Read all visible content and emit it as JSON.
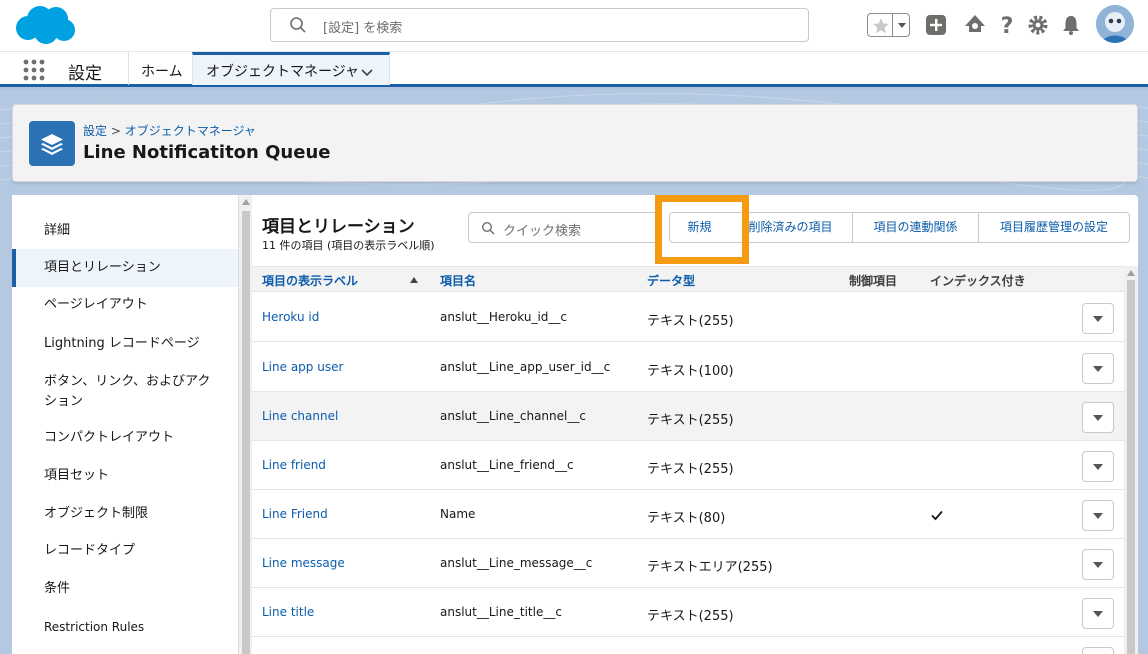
{
  "header": {
    "search_placeholder": "[設定] を検索"
  },
  "nav": {
    "app_name": "設定",
    "tabs": [
      {
        "label": "ホーム"
      },
      {
        "label": "オブジェクトマネージャ"
      }
    ]
  },
  "page": {
    "breadcrumb_root": "設定",
    "breadcrumb_sep": ">",
    "breadcrumb_current": "オブジェクトマネージャ",
    "title": "Line Notificatiton Queue"
  },
  "sidebar": {
    "items": [
      {
        "label": "詳細"
      },
      {
        "label": "項目とリレーション"
      },
      {
        "label": "ページレイアウト"
      },
      {
        "label": "Lightning レコードページ"
      },
      {
        "label": "ボタン、リンク、およびアクション"
      },
      {
        "label": "コンパクトレイアウト"
      },
      {
        "label": "項目セット"
      },
      {
        "label": "オブジェクト制限"
      },
      {
        "label": "レコードタイプ"
      },
      {
        "label": "条件"
      },
      {
        "label": "Restriction Rules"
      }
    ]
  },
  "section": {
    "title": "項目とリレーション",
    "subtitle": "11 件の項目 (項目の表示ラベル順)",
    "quick_search_placeholder": "クイック検索",
    "buttons": {
      "new": "新規",
      "deleted": "削除済みの項目",
      "dependencies": "項目の連動関係",
      "history": "項目履歴管理の設定"
    }
  },
  "table": {
    "columns": [
      "項目の表示ラベル",
      "項目名",
      "データ型",
      "制御項目",
      "インデックス付き"
    ],
    "rows": [
      {
        "label": "Heroku id",
        "name": "anslut__Heroku_id__c",
        "type": "テキスト(255)",
        "indexed": false
      },
      {
        "label": "Line app user",
        "name": "anslut__Line_app_user_id__c",
        "type": "テキスト(100)",
        "indexed": false
      },
      {
        "label": "Line channel",
        "name": "anslut__Line_channel__c",
        "type": "テキスト(255)",
        "indexed": false
      },
      {
        "label": "Line friend",
        "name": "anslut__Line_friend__c",
        "type": "テキスト(255)",
        "indexed": false
      },
      {
        "label": "Line Friend",
        "name": "Name",
        "type": "テキスト(80)",
        "indexed": true
      },
      {
        "label": "Line message",
        "name": "anslut__Line_message__c",
        "type": "テキストエリア(255)",
        "indexed": false
      },
      {
        "label": "Line title",
        "name": "anslut__Line_title__c",
        "type": "テキスト(255)",
        "indexed": false
      }
    ]
  },
  "colors": {
    "brand_blue": "#1b5fa6",
    "link_blue": "#0b5cab",
    "highlight_orange": "#f59b11",
    "logo_blue": "#00a1e0"
  }
}
